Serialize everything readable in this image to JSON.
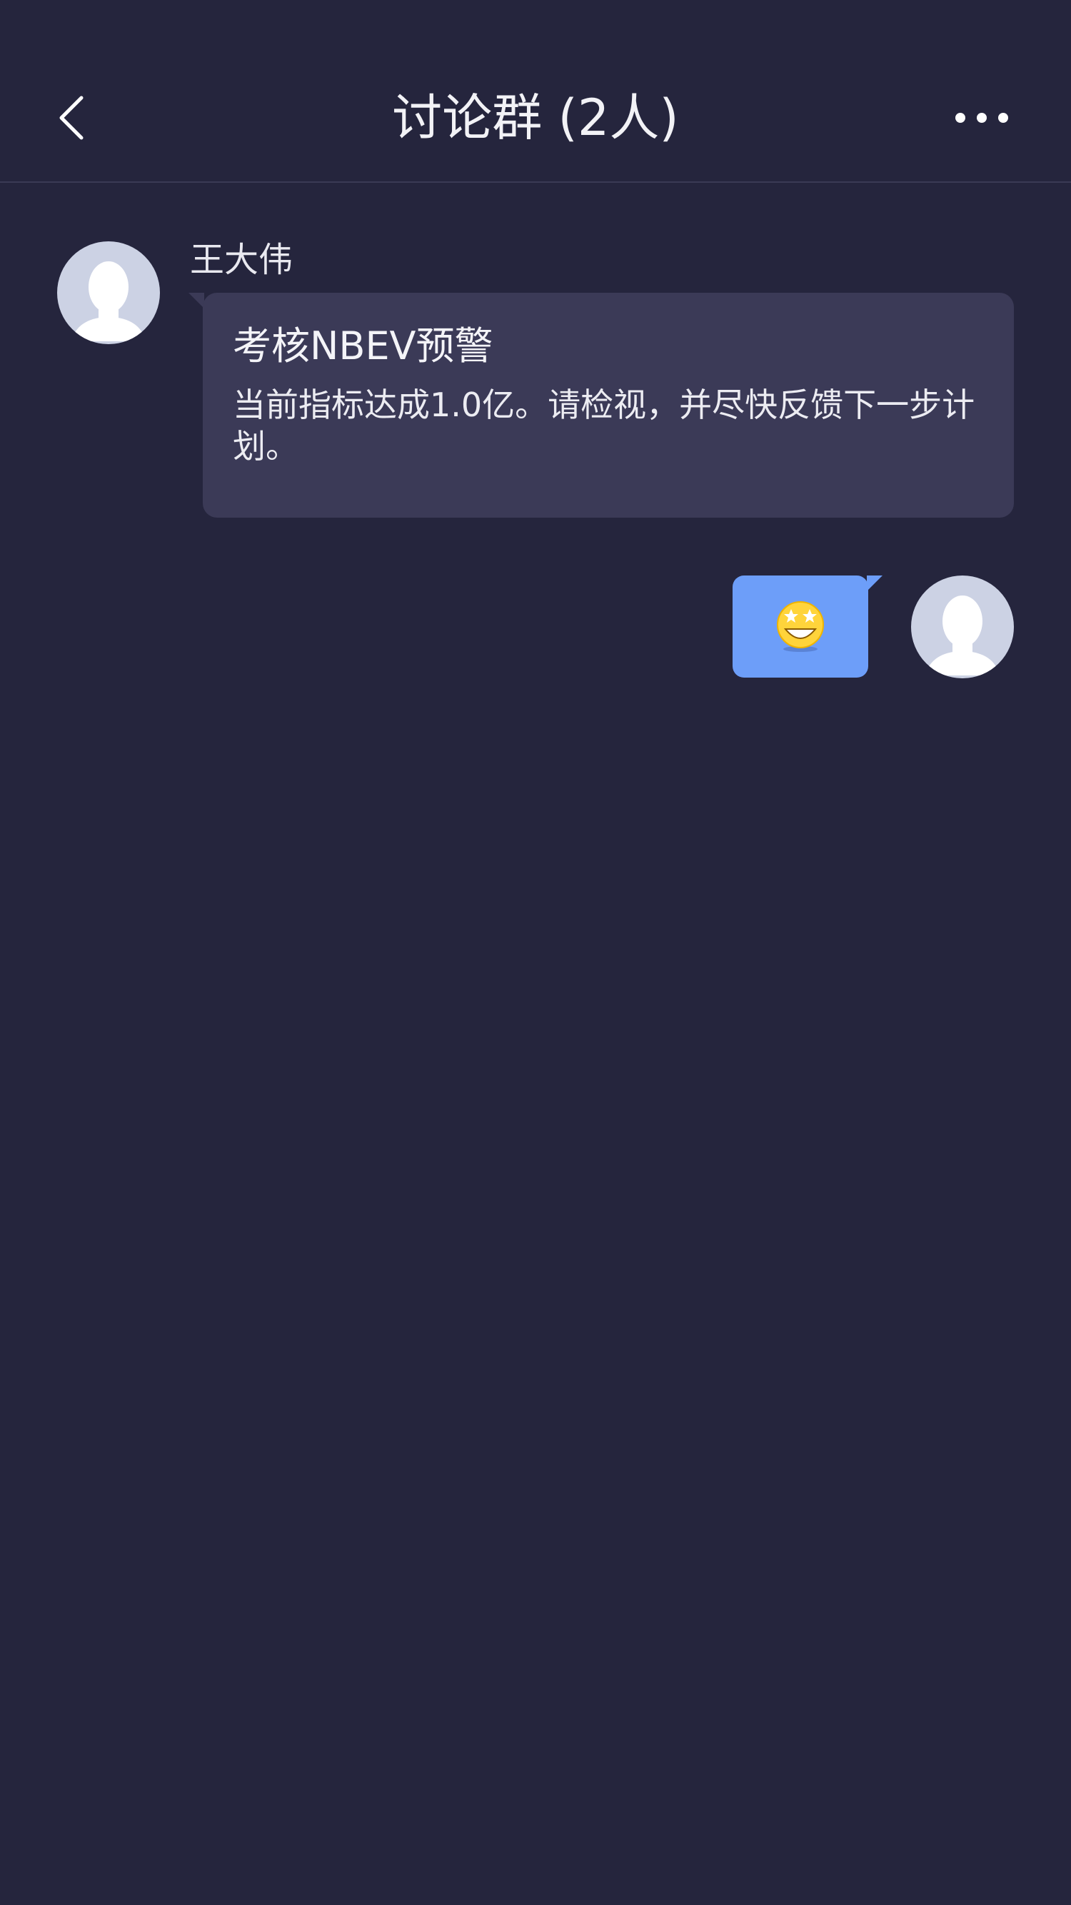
{
  "header": {
    "title": "讨论群 (2人)",
    "back_icon": "chevron-left-icon",
    "more_icon": "ellipsis-icon"
  },
  "messages": [
    {
      "direction": "incoming",
      "sender": "王大伟",
      "title": "考核NBEV预警",
      "body": "当前指标达成1.0亿。请检视，并尽快反馈下一步计划。"
    },
    {
      "direction": "outgoing",
      "content_type": "emoji",
      "emoji": "star-struck-emoji"
    }
  ],
  "colors": {
    "background": "#25253d",
    "incoming_bubble": "#3b3a57",
    "outgoing_bubble": "#6d9ef9",
    "avatar_bg": "#ccd2e4"
  }
}
